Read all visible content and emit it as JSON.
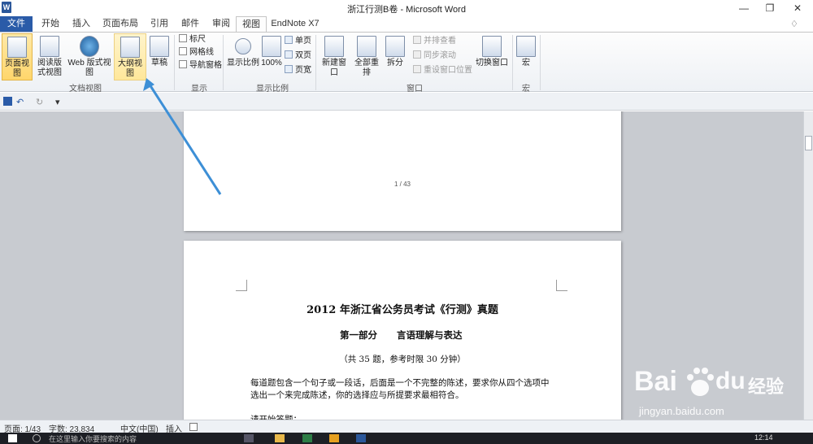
{
  "window": {
    "title": "浙江行测B卷 - Microsoft Word",
    "app_icon_letter": "W",
    "minimize": "—",
    "maximize": "❐",
    "close": "✕"
  },
  "tabs": {
    "file": "文件",
    "items": [
      "开始",
      "插入",
      "页面布局",
      "引用",
      "邮件",
      "审阅",
      "视图",
      "EndNote X7"
    ],
    "active": "视图",
    "collapse": "♢",
    "help": "?"
  },
  "ribbon": {
    "doc_views": {
      "buttons": [
        "页面视图",
        "阅读版式视图",
        "Web 版式视图",
        "大纲视图",
        "草稿"
      ],
      "label": "文档视图"
    },
    "show": {
      "checkboxes": [
        "标尺",
        "网格线",
        "导航窗格"
      ],
      "label": "显示"
    },
    "zoom": {
      "buttons": [
        "显示比例",
        "100%"
      ],
      "small": [
        "单页",
        "双页",
        "页宽"
      ],
      "label": "显示比例"
    },
    "window": {
      "buttons": [
        "新建窗口",
        "全部重排",
        "拆分"
      ],
      "small": [
        "并排查看",
        "同步滚动",
        "重设窗口位置"
      ],
      "switch": "切换窗口",
      "label": "窗口"
    },
    "macro": {
      "button": "宏",
      "label": "宏"
    }
  },
  "qat": {
    "save_icon": "floppy-icon",
    "undo": "↶",
    "redo": "↻",
    "customize": "▾"
  },
  "document": {
    "page1_number": "1 / 43",
    "title": "2012 年浙江省公务员考试《行测》真题",
    "part": "第一部分",
    "part_title": "言语理解与表达",
    "note": "（共 35 题，参考时限 30 分钟）",
    "para1_line1": "每道题包含一个句子或一段话，后面是一个不完整的陈述，要求你从四个选项中",
    "para1_line2": "选出一个来完成陈述，你的选择应与所提要求最相符合。",
    "start": "请开始答题："
  },
  "statusbar": {
    "page": "页面: 1/43",
    "words": "字数: 23,834",
    "lang": "中文(中国)",
    "mode": "插入"
  },
  "taskbar": {
    "search_placeholder": "在这里输入你要搜索的内容",
    "time": "12:14"
  },
  "watermark": {
    "brand": "Bai",
    "brand2": "du",
    "suffix": "经验",
    "url": "jingyan.baidu.com"
  },
  "colors": {
    "accent": "#2a5ba8",
    "highlight": "#ffd66b",
    "arrow": "#3d8fd6",
    "doc_bg": "#c8cbd0"
  }
}
